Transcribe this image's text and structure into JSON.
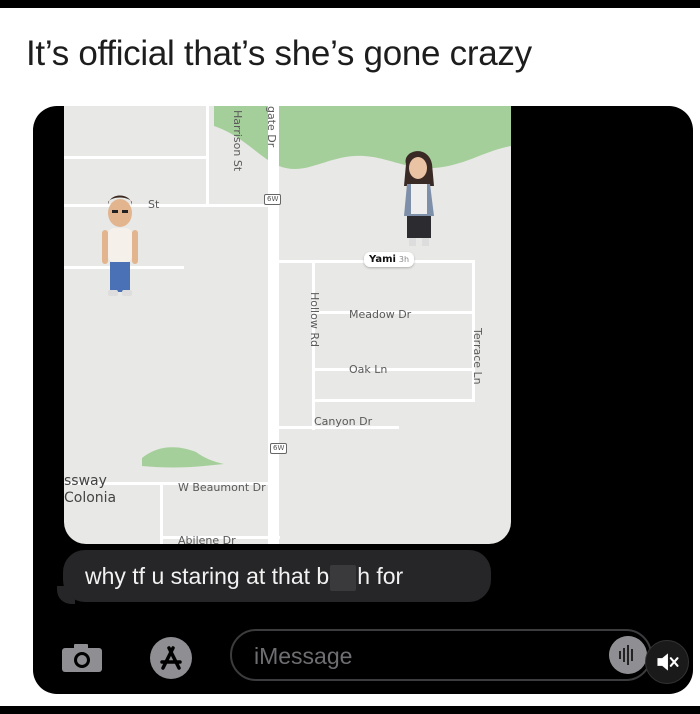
{
  "caption": "It’s official that’s she’s gone crazy",
  "map": {
    "streets": {
      "harrison": "Harrison St",
      "gate": "gate Dr",
      "st_left": "St",
      "hollow": "Hollow Rd",
      "meadow": "Meadow Dr",
      "oak": "Oak Ln",
      "terrace": "Terrace Ln",
      "canyon": "Canyon Dr",
      "beaumont": "W Beaumont Dr",
      "abilene": "Abilene Dr"
    },
    "shields": {
      "top": "6W",
      "bottom": "6W"
    },
    "places": {
      "line1": "ssway",
      "line2": "Colonia"
    },
    "friend_tag": {
      "name": "Yami",
      "age": "3h"
    }
  },
  "message": {
    "before": "why tf u staring at that b",
    "after": "h for"
  },
  "composer": {
    "placeholder": "iMessage"
  },
  "colors": {
    "phone_bg": "#000000",
    "bubble_bg": "#262628",
    "map_bg": "#e8e8e6",
    "park_green": "#a5cf9a"
  }
}
